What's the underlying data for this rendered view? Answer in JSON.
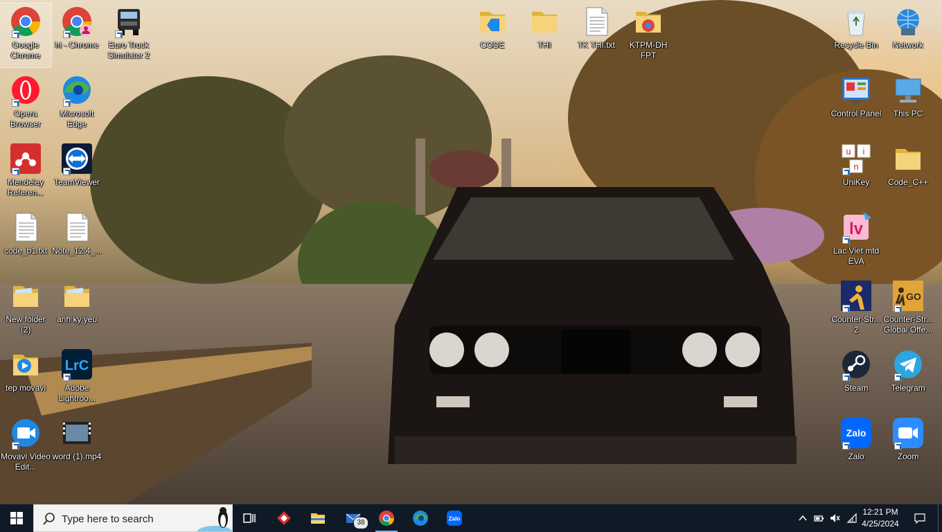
{
  "desktop": {
    "icons": [
      {
        "label": "Google Chrome",
        "icon": "chrome-icon"
      },
      {
        "label": "hi - Chrome",
        "icon": "chrome-profile-icon"
      },
      {
        "label": "Euro Truck Simulator 2",
        "icon": "truck-icon"
      },
      {
        "label": "CODE",
        "icon": "folder-vscode-icon"
      },
      {
        "label": "THI",
        "icon": "folder-icon"
      },
      {
        "label": "TK THI.txt",
        "icon": "text-file-icon"
      },
      {
        "label": "KTPM-DH FPT",
        "icon": "folder-chrome-icon"
      },
      {
        "label": "Recycle Bin",
        "icon": "recycle-bin-icon"
      },
      {
        "label": "Network",
        "icon": "network-icon"
      },
      {
        "label": "Opera Browser",
        "icon": "opera-icon"
      },
      {
        "label": "Microsoft Edge",
        "icon": "edge-icon"
      },
      {
        "label": "Control Panel",
        "icon": "control-panel-icon"
      },
      {
        "label": "This PC",
        "icon": "this-pc-icon"
      },
      {
        "label": "Mendeley Referen...",
        "icon": "mendeley-icon"
      },
      {
        "label": "TeamViewer",
        "icon": "teamviewer-icon"
      },
      {
        "label": "UniKey",
        "icon": "unikey-icon"
      },
      {
        "label": "Code_C++",
        "icon": "folder-icon"
      },
      {
        "label": "code_b1.txt",
        "icon": "text-file-icon"
      },
      {
        "label": "Note_12.4_...",
        "icon": "text-file-icon"
      },
      {
        "label": "Lac Viet mtd EVA",
        "icon": "lacviet-icon"
      },
      {
        "label": "New folder (2)",
        "icon": "folder-images-icon"
      },
      {
        "label": "anh ky yeu",
        "icon": "folder-images-icon"
      },
      {
        "label": "Counter-Str... 2",
        "icon": "counter-strike-icon"
      },
      {
        "label": "Counter-Str... Global Offe...",
        "icon": "csgo-icon"
      },
      {
        "label": "tep movavi",
        "icon": "folder-movavi-icon"
      },
      {
        "label": "Adobe Lightroo...",
        "icon": "lightroom-icon"
      },
      {
        "label": "Steam",
        "icon": "steam-icon"
      },
      {
        "label": "Telegram",
        "icon": "telegram-icon"
      },
      {
        "label": "Movavi Video Edit...",
        "icon": "movavi-icon"
      },
      {
        "label": "word (1).mp4",
        "icon": "video-file-icon"
      },
      {
        "label": "Zalo",
        "icon": "zalo-icon"
      },
      {
        "label": "Zoom",
        "icon": "zoom-icon"
      }
    ]
  },
  "taskbar": {
    "search_placeholder": "Type here to search",
    "mail_badge": "38",
    "apps": [
      "task-view-icon",
      "app-red-icon",
      "file-explorer-icon",
      "mail-icon",
      "chrome-icon",
      "edge-icon",
      "zalo-icon"
    ],
    "time": "12:21 PM",
    "date": "4/25/2024"
  },
  "colors": {
    "taskbar_bg": "#101a26",
    "chrome_red": "#db4437",
    "chrome_yellow": "#f4b400",
    "chrome_green": "#0f9d58",
    "chrome_blue": "#4285f4"
  }
}
